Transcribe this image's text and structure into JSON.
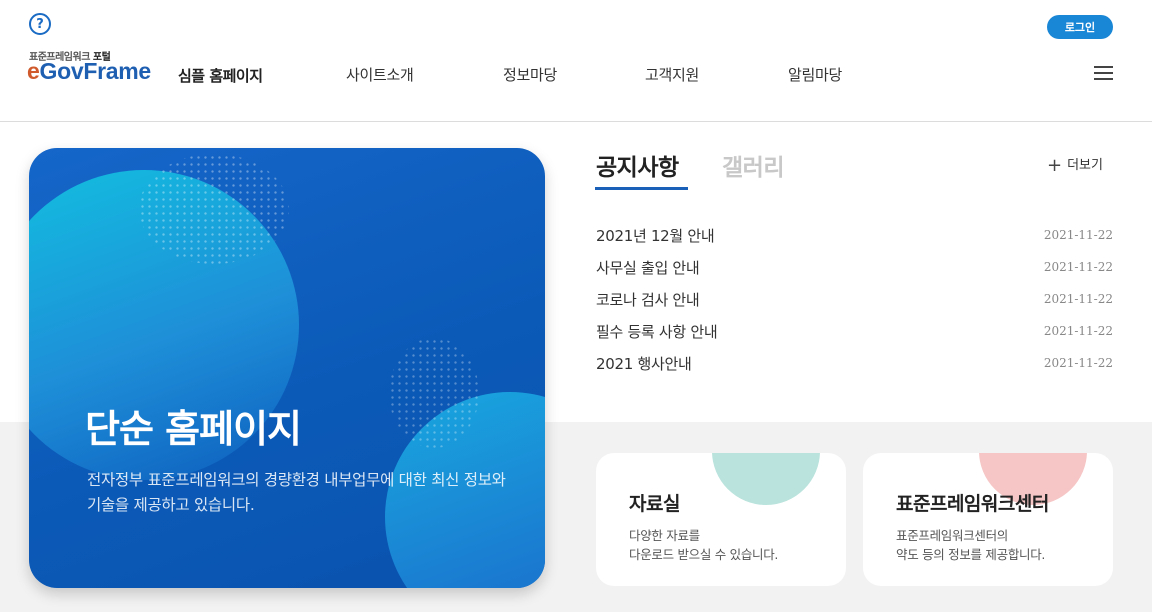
{
  "header": {
    "logo_sub_prefix": "표준프레임워크 ",
    "logo_sub_bold": "포털",
    "logo_e": "e",
    "logo_rest": "GovFrame",
    "logo_title": "심플 홈페이지",
    "gnb": [
      "사이트소개",
      "정보마당",
      "고객지원",
      "알림마당"
    ],
    "login_label": "로그인",
    "help_glyph": "?"
  },
  "hero": {
    "title": "단순 홈페이지",
    "description": "전자정부 표준프레임워크의 경량환경 내부업무에 대한 최신 정보와 기술을 제공하고 있습니다."
  },
  "board": {
    "tabs": [
      "공지사항",
      "갤러리"
    ],
    "active_tab": "공지사항",
    "more_label": "더보기",
    "items": [
      {
        "title": "2021년 12월 안내",
        "date": "2021-11-22"
      },
      {
        "title": "사무실 출입 안내",
        "date": "2021-11-22"
      },
      {
        "title": "코로나 검사 안내",
        "date": "2021-11-22"
      },
      {
        "title": "필수 등록 사항 안내",
        "date": "2021-11-22"
      },
      {
        "title": "2021 행사안내",
        "date": "2021-11-22"
      }
    ]
  },
  "cards": [
    {
      "title": "자료실",
      "description": "다양한 자료를\n다운로드 받으실 수 있습니다.",
      "accent": "#b9e3dc"
    },
    {
      "title": "표준프레임워크센터",
      "description": "표준프레임워크센터의\n약도 등의 정보를 제공합니다.",
      "accent": "#f6c6c6"
    }
  ],
  "colors": {
    "brand_blue": "#1f5fb2",
    "login_blue": "#1a86d6",
    "hero_blue": "#0b5ab8"
  }
}
